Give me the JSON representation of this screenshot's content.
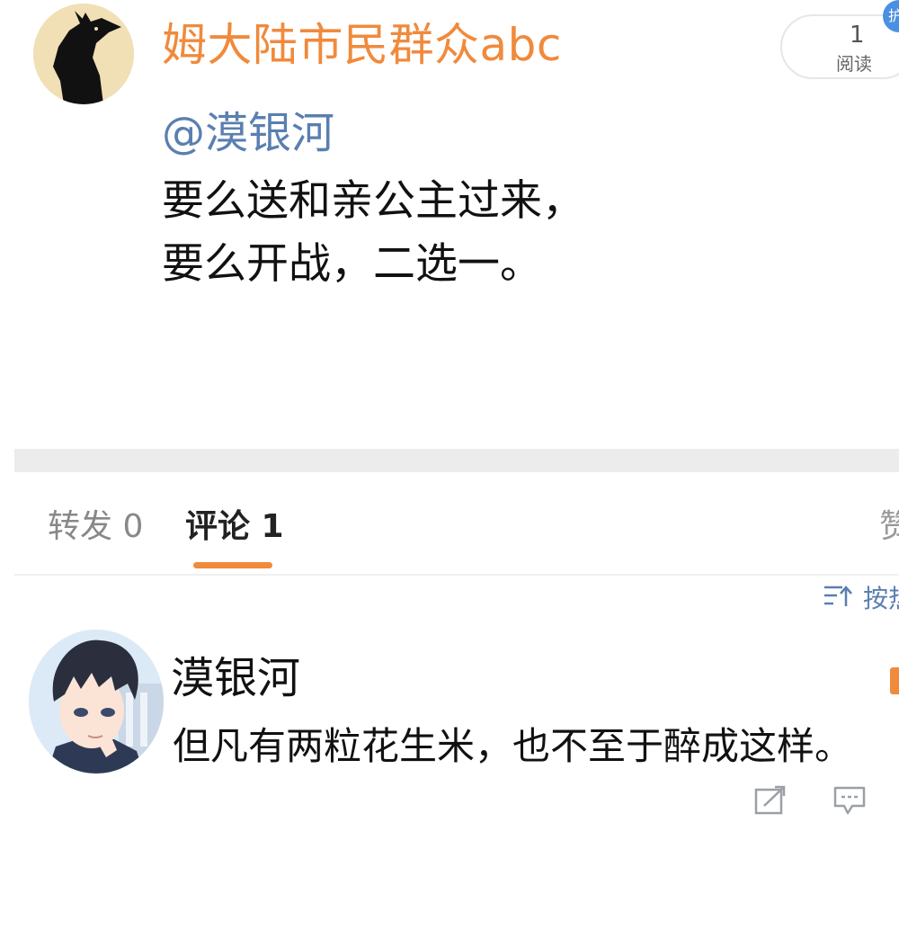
{
  "post": {
    "author": "姆大陆市民群众abc",
    "read_count": "1",
    "read_label": "阅读",
    "pin_badge": "护",
    "mention": "@漠银河",
    "lines": [
      "要么送和亲公主过来，",
      "要么开战，二选一。"
    ]
  },
  "tabs": {
    "repost": "转发 0",
    "comment": "评论 1",
    "like": "赞"
  },
  "sort": {
    "label": "按热"
  },
  "comment": {
    "author": "漠银河",
    "text": "但凡有两粒花生米，也不至于醉成这样。"
  },
  "colors": {
    "accent_orange": "#f08a3c",
    "link_blue": "#5a7fb0",
    "divider_gray": "#ececec"
  },
  "icons": {
    "author_avatar": "black-dog-avatar-icon",
    "commenter_avatar": "anime-boy-avatar-icon",
    "sort": "sort-icon",
    "repost_action": "repost-icon",
    "reply_action": "comment-bubble-icon"
  }
}
